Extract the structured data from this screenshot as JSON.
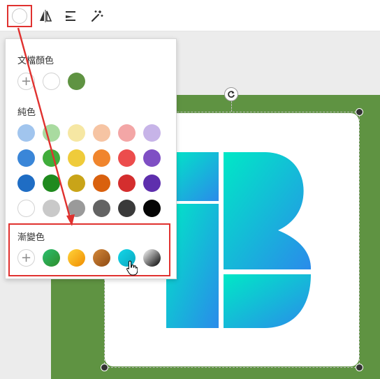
{
  "toolbar": {
    "current_color": "#ffffff",
    "icons": [
      "color-picker-icon",
      "flip-icon",
      "align-icon",
      "magic-wand-icon"
    ]
  },
  "picker": {
    "doc_colors_title": "文檔顏色",
    "doc_colors": [
      "#ffffff",
      "#5f9342"
    ],
    "solid_title": "純色",
    "solid_colors": [
      [
        "#a1c5ee",
        "#a9dba0",
        "#f6e7a3",
        "#f6c4a3",
        "#f3a6a6",
        "#c7b4e8"
      ],
      [
        "#3a86d8",
        "#40ad3b",
        "#efcb3a",
        "#f0852d",
        "#ec4c4c",
        "#7f4fc4"
      ],
      [
        "#1f6dc4",
        "#1f8a1e",
        "#c9a418",
        "#d9610e",
        "#d42e2e",
        "#5e2fad"
      ],
      [
        "#ffffff",
        "#c9c9c9",
        "#9a9a9a",
        "#636363",
        "#3a3a3a",
        "#050505"
      ]
    ],
    "gradient_title": "漸變色",
    "gradients": [
      {
        "from": "#2bc06f",
        "to": "#2e8c2a"
      },
      {
        "from": "#ffd43b",
        "to": "#f08c00"
      },
      {
        "from": "#d4883a",
        "to": "#8e4a12"
      },
      {
        "from": "#14d7e8",
        "to": "#0aa6c0"
      },
      {
        "from": "#ffffff",
        "to": "#000000"
      }
    ]
  },
  "canvas": {
    "background": "#5f9342",
    "logo_gradient_from": "#00e8c6",
    "logo_gradient_to": "#2a8bea"
  },
  "annotation": {
    "highlight_color": "#e0312f"
  }
}
